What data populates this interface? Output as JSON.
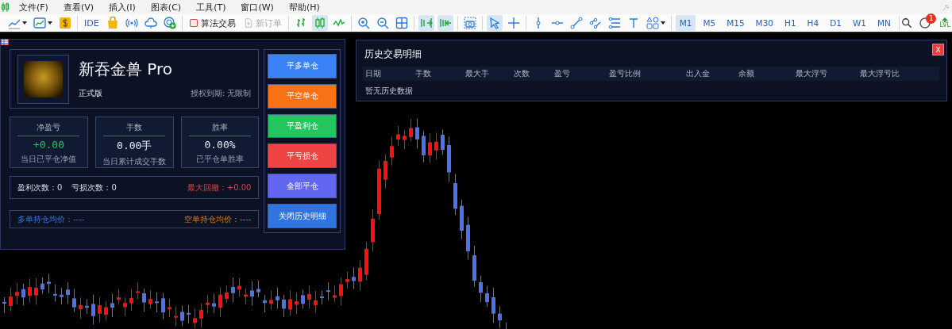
{
  "menu": [
    {
      "label": "文件(F)"
    },
    {
      "label": "查看(V)"
    },
    {
      "label": "插入(I)"
    },
    {
      "label": "图表(C)"
    },
    {
      "label": "工具(T)"
    },
    {
      "label": "窗口(W)"
    },
    {
      "label": "帮助(H)"
    }
  ],
  "toolbar": {
    "groups": [
      [
        {
          "kind": "icon",
          "selected": false
        },
        {
          "kind": "icon",
          "selected": false
        },
        {
          "kind": "icon",
          "selected": false
        }
      ],
      [
        {
          "kind": "label",
          "label": "IDE"
        },
        {
          "kind": "icon",
          "selected": false
        },
        {
          "kind": "icon",
          "selected": false
        },
        {
          "kind": "icon",
          "selected": false
        },
        {
          "kind": "icon",
          "selected": false
        }
      ],
      [
        {
          "kind": "action",
          "label": "算法交易",
          "disabled": false
        },
        {
          "kind": "action",
          "label": "新订单",
          "disabled": true
        }
      ],
      [
        {
          "kind": "icon",
          "selected": false
        },
        {
          "kind": "icon",
          "selected": true
        },
        {
          "kind": "icon",
          "selected": false
        }
      ],
      [
        {
          "kind": "icon",
          "selected": false
        },
        {
          "kind": "icon",
          "selected": false
        },
        {
          "kind": "icon",
          "selected": false
        }
      ],
      [
        {
          "kind": "icon",
          "selected": true
        },
        {
          "kind": "icon",
          "selected": true
        }
      ],
      [
        {
          "kind": "icon",
          "selected": false
        }
      ],
      [
        {
          "kind": "icon",
          "selected": true
        },
        {
          "kind": "icon",
          "selected": false
        }
      ],
      [
        {
          "kind": "icon",
          "selected": false
        },
        {
          "kind": "icon",
          "selected": false
        },
        {
          "kind": "icon",
          "selected": false
        },
        {
          "kind": "icon",
          "selected": false
        },
        {
          "kind": "icon",
          "selected": false
        },
        {
          "kind": "icon",
          "selected": false
        },
        {
          "kind": "icon",
          "selected": false
        }
      ],
      [
        {
          "kind": "timeframe",
          "label": "M1",
          "selected": true
        },
        {
          "kind": "timeframe",
          "label": "M5",
          "selected": false
        },
        {
          "kind": "timeframe",
          "label": "M15",
          "selected": false
        },
        {
          "kind": "timeframe",
          "label": "M30",
          "selected": false
        },
        {
          "kind": "timeframe",
          "label": "H1",
          "selected": false
        },
        {
          "kind": "timeframe",
          "label": "H4",
          "selected": false
        },
        {
          "kind": "timeframe",
          "label": "D1",
          "selected": false
        },
        {
          "kind": "timeframe",
          "label": "W1",
          "selected": false
        },
        {
          "kind": "timeframe",
          "label": "MN",
          "selected": false
        }
      ]
    ],
    "notification_count": "1",
    "lvl_label": "LVL"
  },
  "ea_panel": {
    "title": "新吞金兽 Pro",
    "edition": "正式版",
    "license": "授权到期: 无限制",
    "stats": [
      {
        "label": "净盈亏",
        "value": "+0.00",
        "note": "当日已平仓净值",
        "positive": true
      },
      {
        "label": "手数",
        "value": "0.00手",
        "note": "当日累计成交手数",
        "positive": false
      },
      {
        "label": "胜率",
        "value": "0.00%",
        "note": "已平仓单胜率",
        "positive": false
      }
    ],
    "win_count": "盈利次数：0",
    "loss_count": "亏损次数：0",
    "max_drawdown": "最大回撤：+0.00",
    "long_avg": "多单持仓均价：----",
    "short_avg": "空单持仓均价：----",
    "buttons": [
      {
        "label": "平多单仓",
        "color": "#3b82f6"
      },
      {
        "label": "平空单仓",
        "color": "#f97316"
      },
      {
        "label": "平盈利仓",
        "color": "#22c55e"
      },
      {
        "label": "平亏损仓",
        "color": "#ef4444"
      },
      {
        "label": "全部平仓",
        "color": "#6366f1"
      },
      {
        "label": "关闭历史明细",
        "color": "#2f74e0"
      }
    ]
  },
  "history": {
    "title": "历史交易明细",
    "close": "X",
    "columns": [
      "日期",
      "手数",
      "最大手",
      "次数",
      "盈亏",
      "盈亏比例",
      "出入金",
      "余额",
      "最大浮亏",
      "最大浮亏比"
    ],
    "empty": "暂无历史数据"
  }
}
